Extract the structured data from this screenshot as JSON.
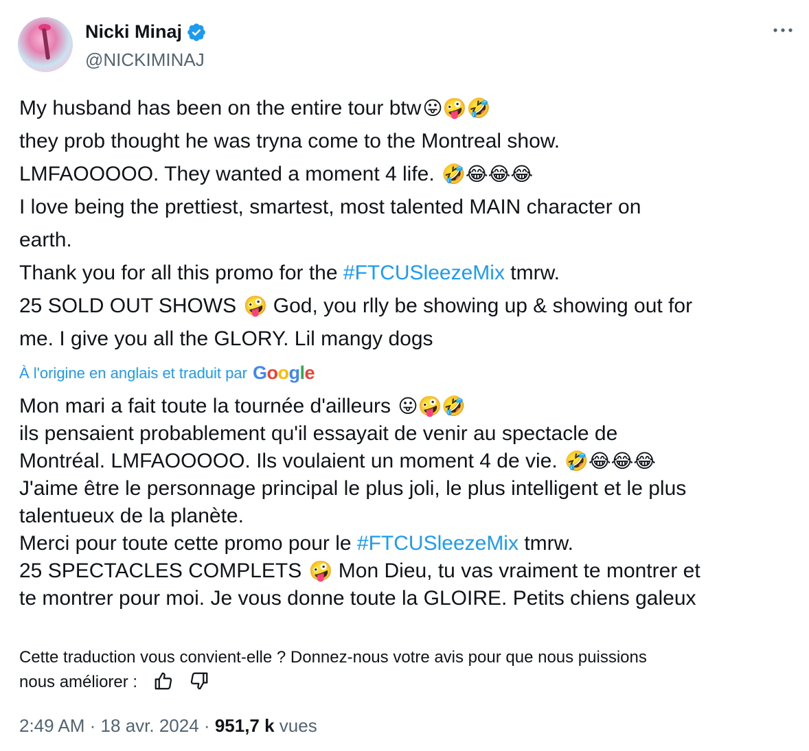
{
  "author": {
    "name": "Nicki Minaj",
    "handle": "@NICKIMINAJ"
  },
  "tweet": {
    "lines": [
      {
        "text": "My husband has been on the entire tour btw",
        "emojis": "😛🤪🤣"
      },
      {
        "text": "they prob thought he was tryna come to the Montreal show."
      },
      {
        "text": "LMFAOOOOO. They wanted a moment 4 life. ",
        "emojis": "🤣😂😂😂"
      },
      {
        "text": "I love being the prettiest, smartest, most talented MAIN character on"
      },
      {
        "text": "earth."
      },
      {
        "before": "Thank you for all this promo for the ",
        "hashtag": "#FTCUSleezeMix",
        "after": " tmrw."
      },
      {
        "text": "25 SOLD OUT SHOWS ",
        "emojis": "🤪",
        "after": " God, you rlly be showing up & showing out for"
      },
      {
        "text": "me. I give you all the GLORY. Lil mangy dogs"
      }
    ]
  },
  "translation_notice": {
    "label": "À l'origine en anglais et traduit par",
    "provider": "Google"
  },
  "translation": {
    "lines": [
      {
        "text": "Mon mari a fait toute la tournée d'ailleurs ",
        "emojis": "😛🤪🤣"
      },
      {
        "text": "ils pensaient probablement qu'il essayait de venir au spectacle de"
      },
      {
        "text": "Montréal. LMFAOOOOO. Ils voulaient un moment 4 de vie. ",
        "emojis": "🤣😂😂😂"
      },
      {
        "text": "J'aime être le personnage principal le plus joli, le plus intelligent et le plus"
      },
      {
        "text": "talentueux de la planète."
      },
      {
        "before": "Merci pour toute cette promo pour le ",
        "hashtag": "#FTCUSleezeMix",
        "after": " tmrw."
      },
      {
        "text": "25 SPECTACLES COMPLETS ",
        "emojis": "🤪",
        "after": " Mon Dieu, tu vas vraiment te montrer et"
      },
      {
        "text": "te montrer pour moi. Je vous donne toute la GLOIRE. Petits chiens galeux"
      }
    ]
  },
  "feedback": {
    "line1": "Cette traduction vous convient-elle ? Donnez-nous votre avis pour que nous puissions",
    "line2": "nous améliorer :"
  },
  "meta": {
    "time": "2:49 AM",
    "separator": "·",
    "date": "18 avr. 2024",
    "views_count": "951,7 k",
    "views_label": "vues"
  },
  "icons": [
    "verified-badge-icon",
    "more-icon",
    "thumbs-up-icon",
    "thumbs-down-icon"
  ],
  "colors": {
    "link": "#1d9bf0",
    "secondary": "#536471",
    "text": "#0f1419"
  }
}
